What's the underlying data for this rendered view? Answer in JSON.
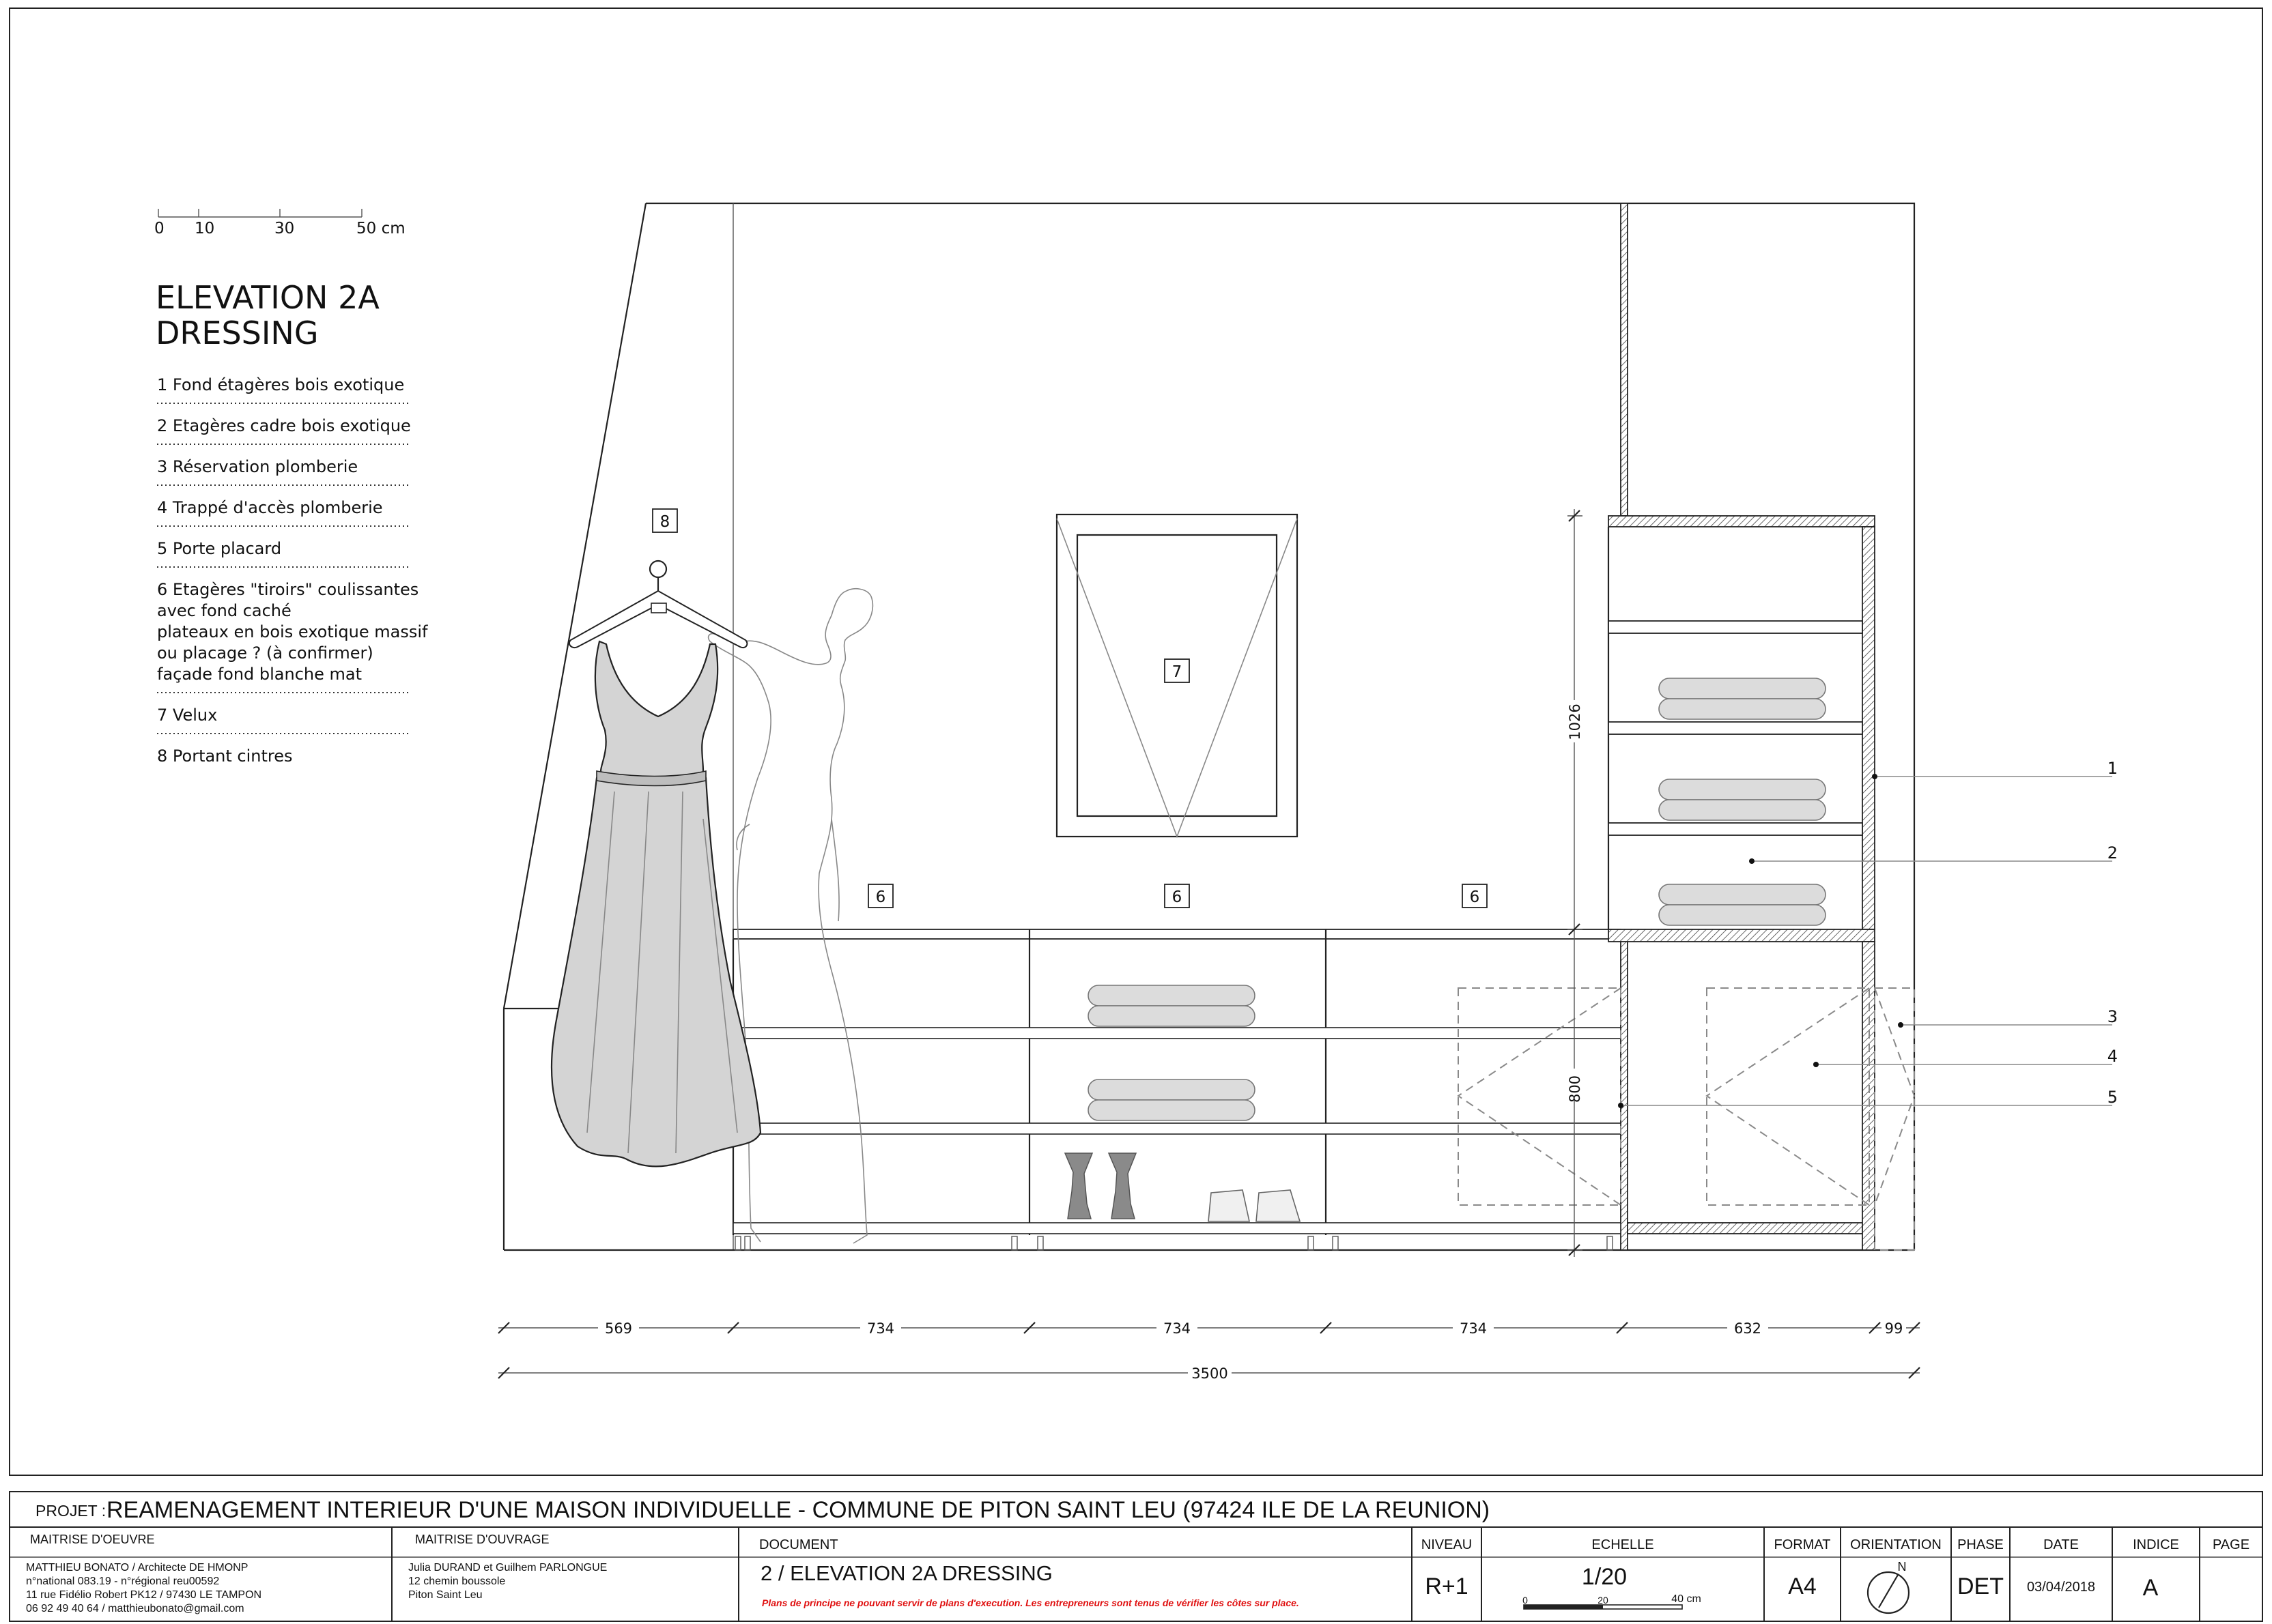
{
  "scale_bar": {
    "ticks": [
      "0",
      "10",
      "30",
      "50 cm"
    ]
  },
  "title": {
    "line1": "ELEVATION 2A",
    "line2": "DRESSING"
  },
  "legend": [
    [
      "1 Fond étagères bois exotique"
    ],
    [
      "2 Etagères cadre bois exotique"
    ],
    [
      "3 Réservation plomberie"
    ],
    [
      "4 Trappé d'accès plomberie"
    ],
    [
      "5 Porte placard"
    ],
    [
      "6 Etagères \"tiroirs\" coulissantes",
      "avec fond caché",
      "plateaux en bois exotique massif",
      "ou placage ? (à confirmer)",
      "façade fond blanche mat"
    ],
    [
      "7 Velux"
    ],
    [
      "8 Portant cintres"
    ]
  ],
  "tags": {
    "hanger": "8",
    "velux": "7",
    "drawer": "6"
  },
  "callouts": [
    "1",
    "2",
    "3",
    "4",
    "5"
  ],
  "dimensions": {
    "horizontal": [
      "569",
      "734",
      "734",
      "734",
      "632",
      "99"
    ],
    "total": "3500",
    "shelf_height": "1026",
    "cabinet_height": "800"
  },
  "title_block": {
    "projet_label": "PROJET :",
    "projet": "REAMENAGEMENT INTERIEUR D'UNE MAISON INDIVIDUELLE - COMMUNE DE PITON SAINT LEU (97424 ILE DE LA REUNION)",
    "moe_label": "MAITRISE D'OEUVRE",
    "moe_lines": [
      "MATTHIEU BONATO / Architecte DE HMONP",
      "n°national 083.19 - n°régional reu00592",
      "11 rue Fidélio Robert PK12 / 97430 LE TAMPON",
      "06 92 49 40 64 / matthieubonato@gmail.com"
    ],
    "mo_label": "MAITRISE D'OUVRAGE",
    "mo_lines": [
      "Julia DURAND et Guilhem PARLONGUE",
      "12 chemin boussole",
      "Piton Saint Leu"
    ],
    "document_label": "DOCUMENT",
    "document": "2 / ELEVATION 2A DRESSING",
    "warning": "Plans de principe ne pouvant servir de plans d'execution. Les entrepreneurs sont tenus de vérifier les côtes sur place.",
    "niveau_label": "NIVEAU",
    "niveau": "R+1",
    "echelle_label": "ECHELLE",
    "echelle": "1/20",
    "echelle_ticks": [
      "0",
      "20",
      "40 cm"
    ],
    "format_label": "FORMAT",
    "format": "A4",
    "orientation_label": "ORIENTATION",
    "north": "N",
    "phase_label": "PHASE",
    "phase": "DET",
    "date_label": "DATE",
    "date": "03/04/2018",
    "indice_label": "INDICE",
    "indice": "A",
    "page_label": "PAGE"
  },
  "colors": {
    "warning": "#e01010",
    "garment": "#d4d4d4",
    "towel": "#dcdcdc"
  }
}
